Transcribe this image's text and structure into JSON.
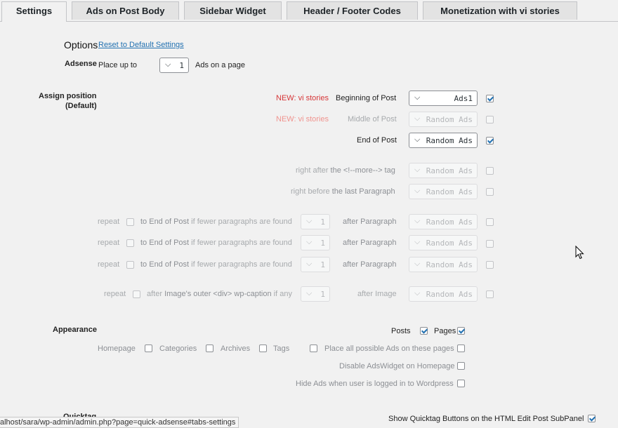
{
  "tabs": [
    {
      "label": "Settings",
      "active": true
    },
    {
      "label": "Ads on Post Body"
    },
    {
      "label": "Sidebar Widget"
    },
    {
      "label": "Header / Footer Codes"
    },
    {
      "label": "Monetization with vi stories"
    }
  ],
  "options": {
    "heading": "Options",
    "reset_link": "Reset to Default Settings",
    "adsense_label": "Adsense",
    "place_up_to": "Place up to",
    "ads_count": "1",
    "ads_on_page": "Ads on a page"
  },
  "assign": {
    "label_line1": "Assign position",
    "label_line2": "(Default)",
    "rows": {
      "beginning": {
        "badge": "NEW: vi stories",
        "label": "Beginning of Post",
        "value": "Ads1",
        "checked": true
      },
      "middle": {
        "badge": "NEW: vi stories",
        "label": "Middle of Post",
        "value": "Random Ads",
        "checked": false
      },
      "end": {
        "label": "End of Post",
        "value": "Random Ads",
        "checked": true
      },
      "more": {
        "pre": "right after",
        "label": "the <!--more--> tag",
        "value": "Random Ads"
      },
      "last_para": {
        "pre": "right before",
        "label": "the last Paragraph",
        "value": "Random Ads"
      }
    },
    "repeat_rows": [
      {
        "repeat": "repeat",
        "to_end": "to End of Post",
        "if_fewer": "if fewer paragraphs are found",
        "num": "1",
        "after": "after Paragraph",
        "value": "Random Ads"
      },
      {
        "repeat": "repeat",
        "to_end": "to End of Post",
        "if_fewer": "if fewer paragraphs are found",
        "num": "1",
        "after": "after Paragraph",
        "value": "Random Ads"
      },
      {
        "repeat": "repeat",
        "to_end": "to End of Post",
        "if_fewer": "if fewer paragraphs are found",
        "num": "1",
        "after": "after Paragraph",
        "value": "Random Ads"
      }
    ],
    "image_row": {
      "repeat": "repeat",
      "after_pre": "after",
      "outer": "Image's outer <div> wp-caption",
      "if_any": "if any",
      "num": "1",
      "after_image": "after Image",
      "value": "Random Ads"
    }
  },
  "appearance": {
    "label": "Appearance",
    "posts": "Posts",
    "pages": "Pages",
    "homepage": "Homepage",
    "categories": "Categories",
    "archives": "Archives",
    "tags": "Tags",
    "place_all": "Place all possible Ads on these pages",
    "disable_widget": "Disable AdsWidget on Homepage",
    "hide_ads": "Hide Ads when user is logged in to Wordpress"
  },
  "quicktag": {
    "label_partial": "Quicktag",
    "text": "Show Quicktag Buttons on the HTML Edit Post SubPanel"
  },
  "status_url": "alhost/sara/wp-admin/admin.php?page=quick-adsense#tabs-settings"
}
